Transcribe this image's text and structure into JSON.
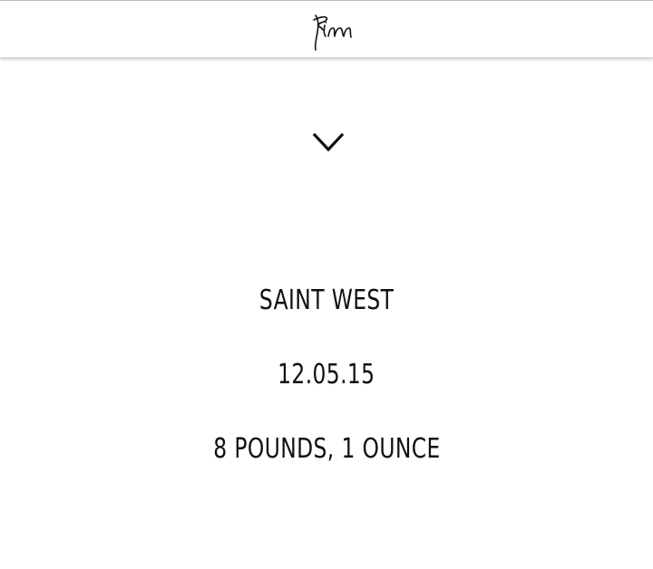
{
  "header": {
    "logo_text": "kim",
    "logo_icon": "kim-signature-logo"
  },
  "scroll_indicator": {
    "icon": "chevron-down-icon"
  },
  "announcement": {
    "name": "SAINT WEST",
    "date": "12.05.15",
    "weight": "8 POUNDS, 1 OUNCE"
  },
  "colors": {
    "background": "#ffffff",
    "text": "#111111",
    "header_border": "#bdbdbd"
  }
}
